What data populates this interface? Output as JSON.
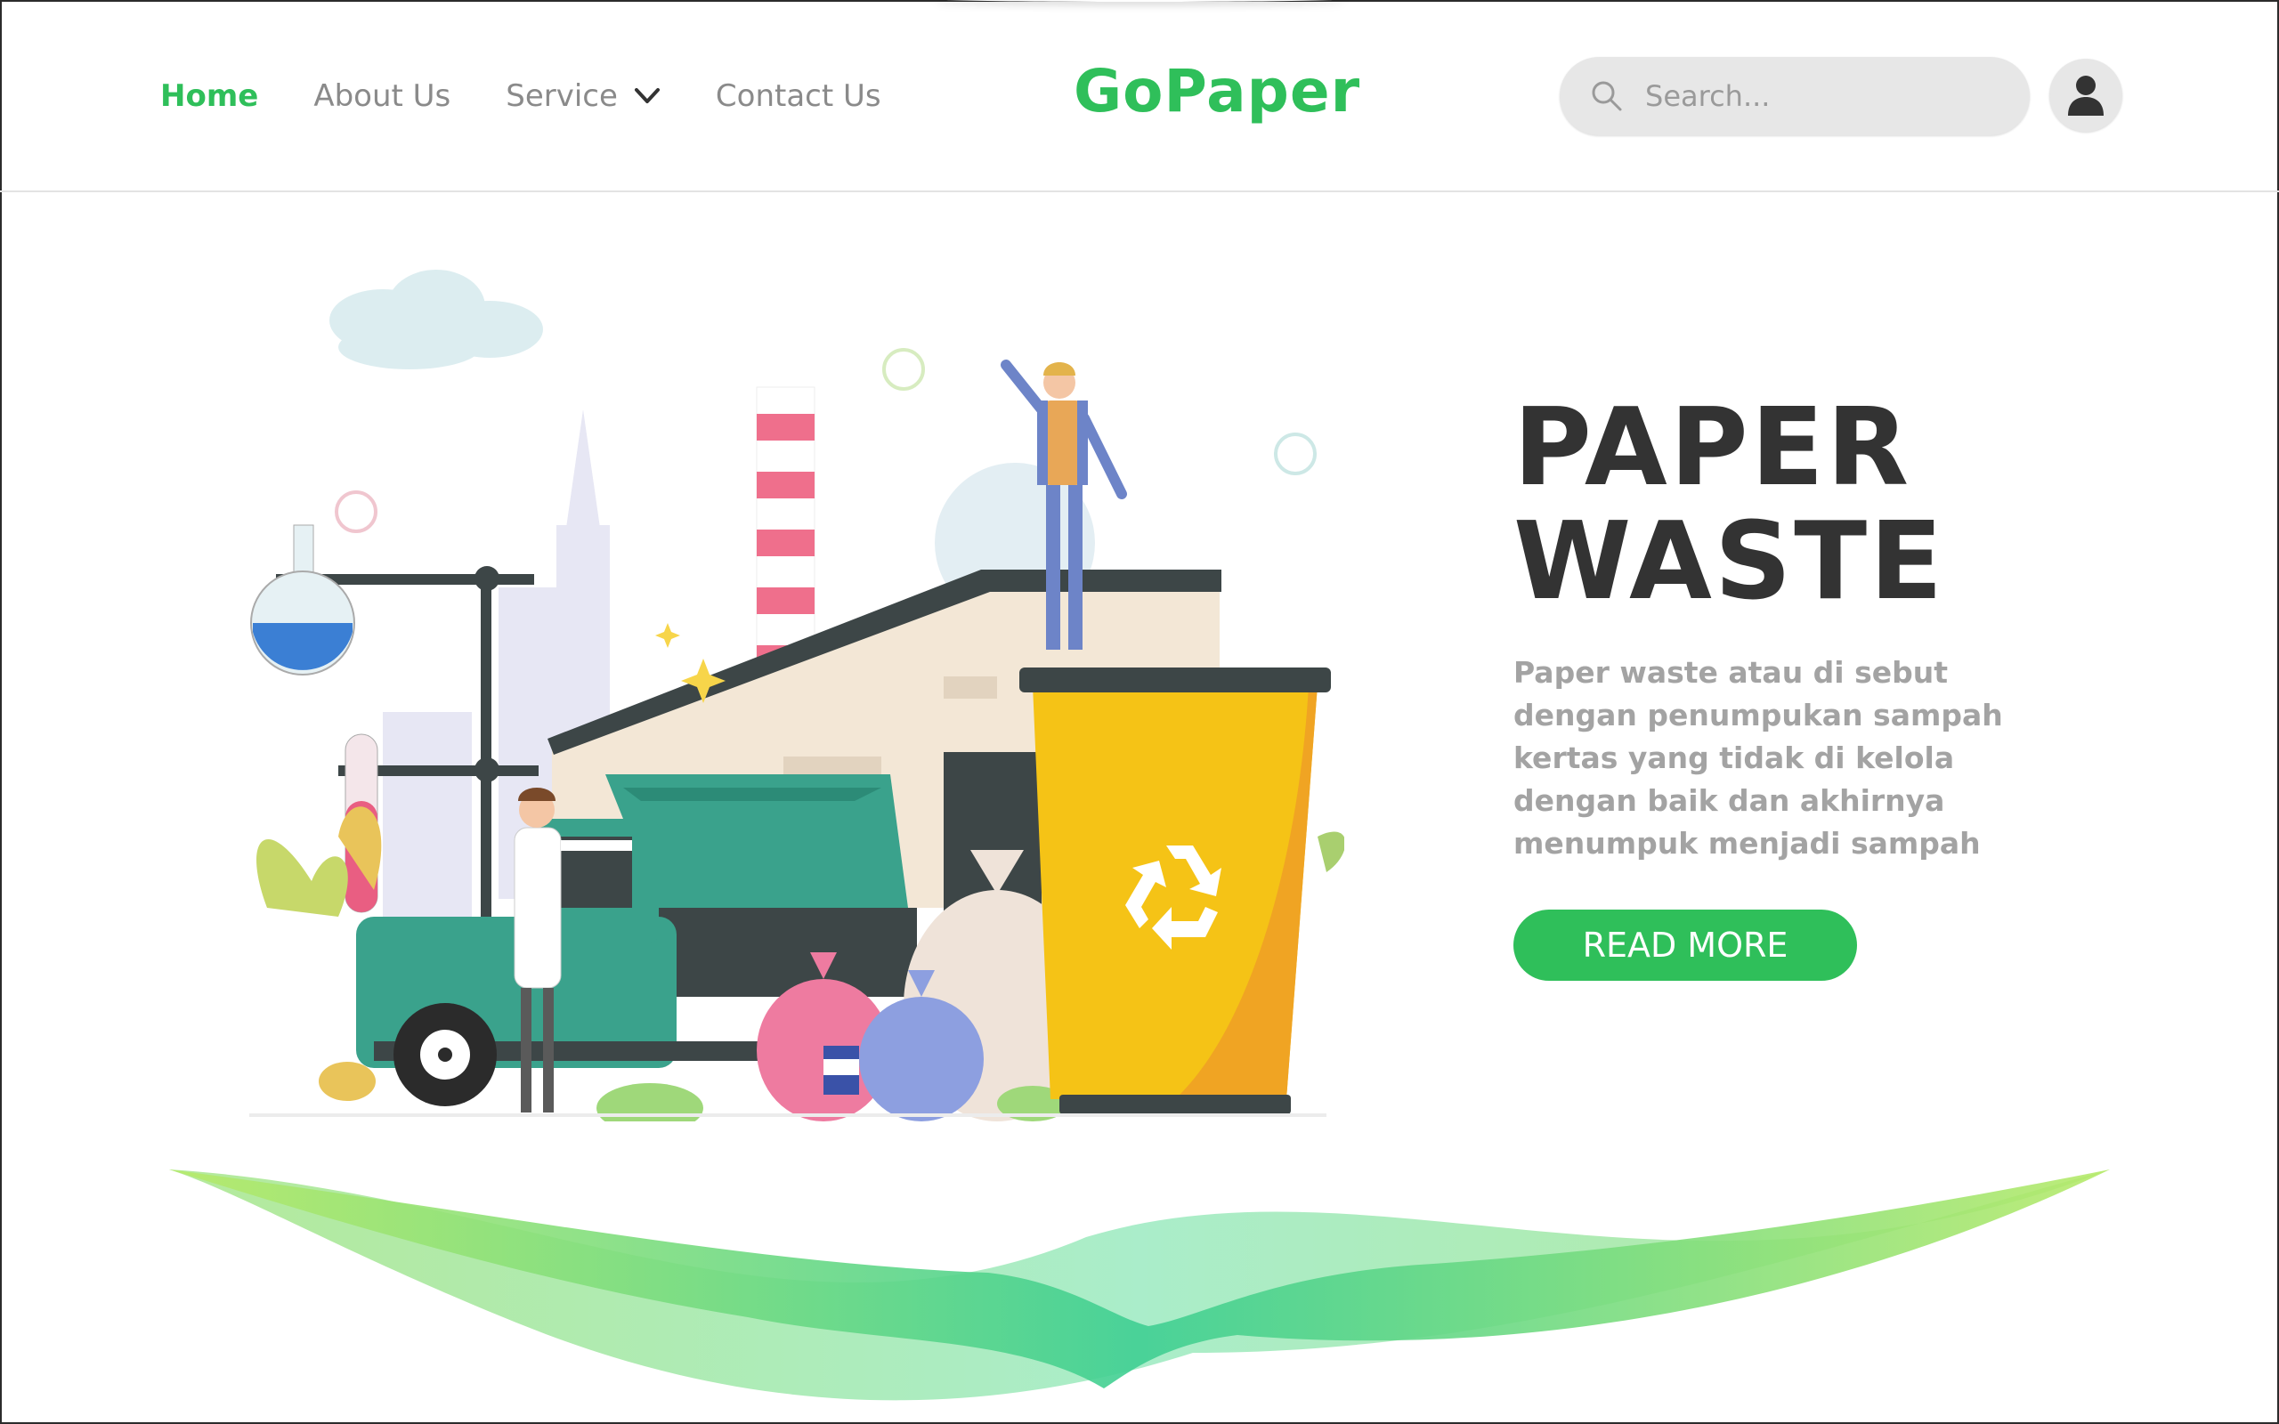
{
  "nav": {
    "items": [
      {
        "label": "Home",
        "active": true
      },
      {
        "label": "About Us",
        "active": false
      },
      {
        "label": "Service",
        "active": false,
        "has_dropdown": true
      },
      {
        "label": "Contact Us",
        "active": false
      }
    ]
  },
  "brand": {
    "name": "GoPaper",
    "color": "#2fbf5a"
  },
  "search": {
    "placeholder": "Search..."
  },
  "user": {
    "icon": "user-icon"
  },
  "hero": {
    "title_line1": "PAPER",
    "title_line2": "WASTE",
    "description": "Paper waste atau di sebut dengan penumpukan sampah kertas yang tidak di kelola dengan baik dan akhirnya menumpuk menjadi sampah",
    "cta_label": "READ MORE",
    "illustration": "recycling-factory-illustration"
  },
  "colors": {
    "accent": "#2fbf5a",
    "text_dark": "#333333",
    "text_muted": "#a3a3a3"
  }
}
